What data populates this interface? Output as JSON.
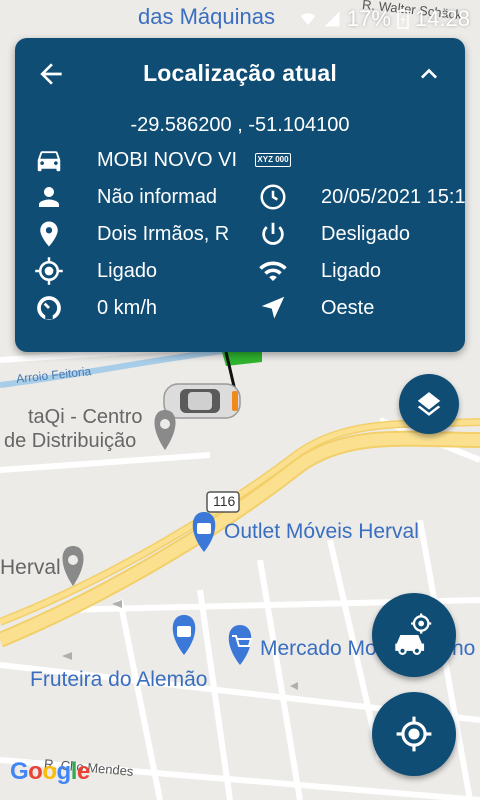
{
  "status_bar": {
    "battery": "17%",
    "time": "14:28"
  },
  "panel": {
    "title": "Localização atual",
    "coordinates": "-29.586200 , -51.104100",
    "vehicle": "MOBI NOVO VI",
    "plate_badge": "XYZ 000",
    "driver": "Não informad",
    "datetime": "20/05/2021 15:1",
    "address": "Dois Irmãos, R",
    "ignition": "Desligado",
    "gps": "Ligado",
    "signal": "Ligado",
    "speed": "0 km/h",
    "direction": "Oeste"
  },
  "map": {
    "top_labels": [
      "das Máquinas",
      "R. Walter Schäck"
    ],
    "labels": {
      "arroio": "Arroio Feitoria",
      "taqi_line1": "taQi - Centro",
      "taqi_line2": "de Distribuição",
      "route": "116",
      "outlet": "Outlet Móveis Herval",
      "herval": "Herval",
      "mercado": "Mercado Mo",
      "mercado_tail": "ho",
      "fruteira": "Fruteira do Alemão",
      "street_bottom": "R. Cl    o Mendes",
      "google": [
        "G",
        "o",
        "o",
        "g",
        "l",
        "e"
      ]
    }
  },
  "colors": {
    "panel_bg": "#0f4d75",
    "poi_blue": "#3b78d8",
    "road_yellow": "#fbe18f",
    "water": "#a8cde8"
  }
}
